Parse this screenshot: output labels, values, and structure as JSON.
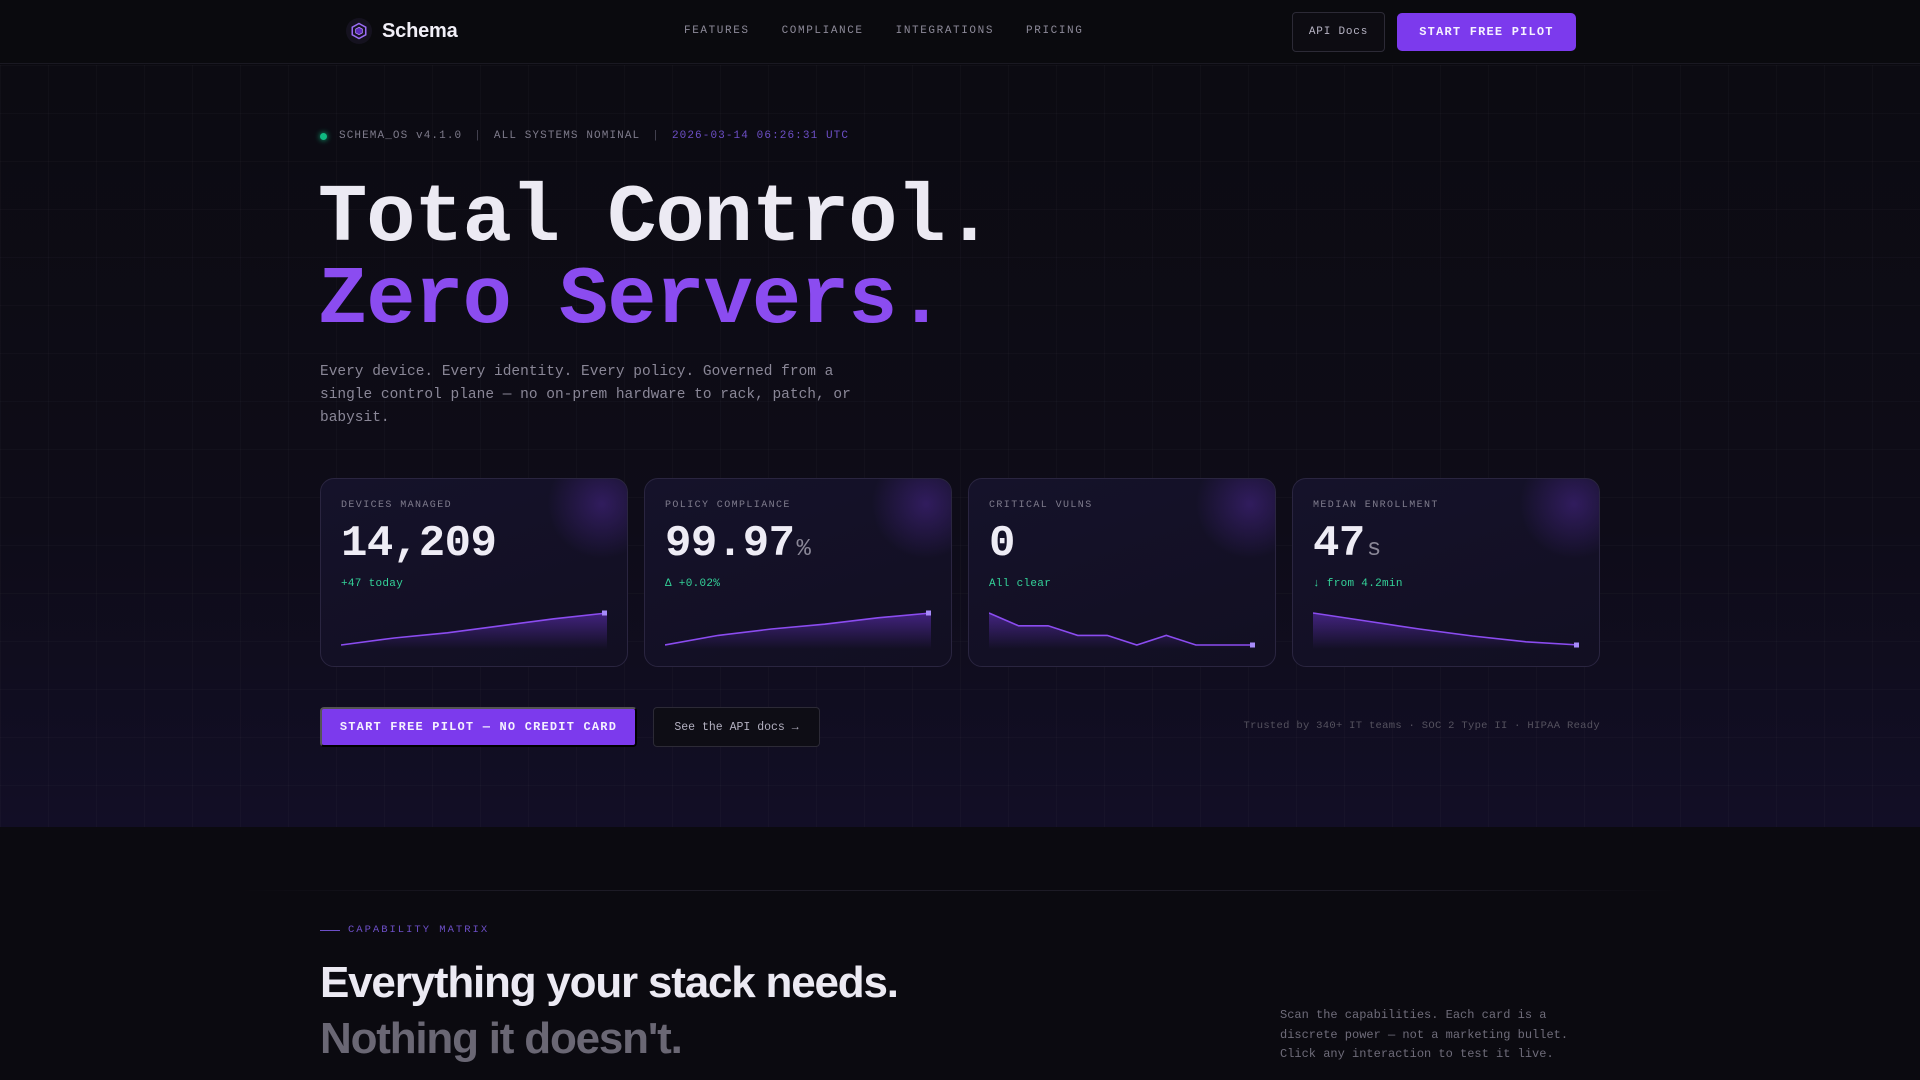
{
  "nav": {
    "brand": "Schema",
    "links": [
      "FEATURES",
      "COMPLIANCE",
      "INTEGRATIONS",
      "PRICING"
    ],
    "api_docs": "API Docs",
    "cta": "START FREE PILOT"
  },
  "hero": {
    "status": {
      "version": "SCHEMA_OS v4.1.0",
      "sep": "|",
      "state": "ALL SYSTEMS NOMINAL",
      "timestamp": "2026-03-14 06:26:31 UTC"
    },
    "title_line1": "Total Control.",
    "title_line2": "Zero Servers.",
    "subtitle": "Every device. Every identity. Every policy. Governed from a single control plane — no on-prem hardware to rack, patch, or babysit.",
    "cards": [
      {
        "label": "DEVICES MANAGED",
        "value": "14,209",
        "unit": "",
        "delta": "+47 today",
        "trend": [
          0.0,
          0.22,
          0.38,
          0.6,
          0.82,
          1.0
        ],
        "down": false
      },
      {
        "label": "POLICY COMPLIANCE",
        "value": "99.97",
        "unit": "%",
        "delta": "Δ +0.02%",
        "trend": [
          0.0,
          0.3,
          0.5,
          0.65,
          0.85,
          1.0
        ],
        "down": false
      },
      {
        "label": "CRITICAL VULNS",
        "value": "0",
        "unit": "",
        "delta": "All clear",
        "trend": [
          1.0,
          0.6,
          0.6,
          0.3,
          0.3,
          0.0,
          0.3,
          0.0,
          0.0,
          0.0
        ],
        "down": true
      },
      {
        "label": "MEDIAN ENROLLMENT",
        "value": "47",
        "unit": "s",
        "delta": "↓ from 4.2min",
        "trend": [
          1.0,
          0.75,
          0.5,
          0.28,
          0.1,
          0.0
        ],
        "down": true
      }
    ],
    "cta_primary": "START FREE PILOT — NO CREDIT CARD",
    "cta_secondary": "See the API docs →",
    "trust": "Trusted by 340+ IT teams · SOC 2 Type II · HIPAA Ready"
  },
  "section2": {
    "eyebrow": "CAPABILITY MATRIX",
    "title_line1": "Everything your stack needs.",
    "title_line2": "Nothing it doesn't.",
    "description": "Scan the capabilities. Each card is a discrete power — not a marketing bullet. Click any interaction to test it live."
  },
  "colors": {
    "accent": "#7c3aed",
    "success": "#10b981",
    "background": "#0b0a10"
  }
}
